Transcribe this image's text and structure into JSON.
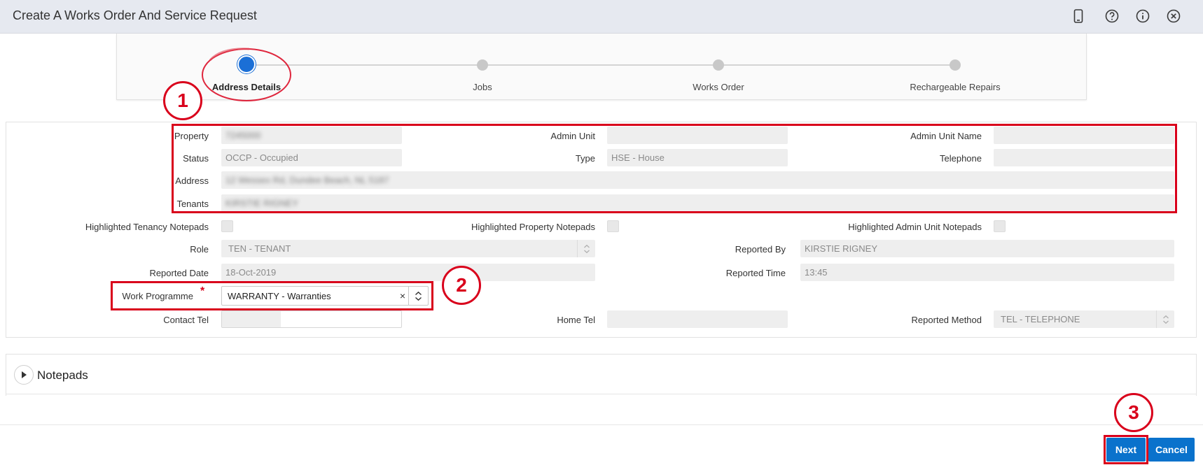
{
  "header": {
    "title": "Create A Works Order And Service Request"
  },
  "train": {
    "stops": [
      {
        "label": "Address Details",
        "active": true
      },
      {
        "label": "Jobs",
        "active": false
      },
      {
        "label": "Works Order",
        "active": false
      },
      {
        "label": "Rechargeable Repairs",
        "active": false
      }
    ]
  },
  "form": {
    "property": {
      "label": "Property",
      "value": "7245000"
    },
    "admin_unit": {
      "label": "Admin Unit",
      "value": ""
    },
    "admin_unit_name": {
      "label": "Admin Unit Name",
      "value": ""
    },
    "status": {
      "label": "Status",
      "value": "OCCP - Occupied"
    },
    "type": {
      "label": "Type",
      "value": "HSE - House"
    },
    "telephone": {
      "label": "Telephone",
      "value": ""
    },
    "address": {
      "label": "Address",
      "value": "12 Wessex Rd, Dundee Beach, NL 5187"
    },
    "tenants": {
      "label": "Tenants",
      "value": "KIRSTIE RIGNEY"
    },
    "highlighted_tenancy": {
      "label": "Highlighted Tenancy Notepads"
    },
    "highlighted_property": {
      "label": "Highlighted Property Notepads"
    },
    "highlighted_admin": {
      "label": "Highlighted Admin Unit Notepads"
    },
    "role": {
      "label": "Role",
      "value": "TEN - TENANT"
    },
    "reported_by": {
      "label": "Reported By",
      "value": "KIRSTIE RIGNEY"
    },
    "reported_date": {
      "label": "Reported Date",
      "value": "18-Oct-2019"
    },
    "reported_time": {
      "label": "Reported Time",
      "value": "13:45"
    },
    "work_programme": {
      "label": "Work Programme",
      "required_mark": "*",
      "value": "WARRANTY - Warranties",
      "clear": "×"
    },
    "contact_tel": {
      "label": "Contact Tel",
      "value": ""
    },
    "home_tel": {
      "label": "Home Tel",
      "value": ""
    },
    "reported_method": {
      "label": "Reported Method",
      "value": "TEL - TELEPHONE"
    }
  },
  "annotations": [
    "1",
    "2",
    "3"
  ],
  "notepads": {
    "label": "Notepads"
  },
  "footer": {
    "next_label": "Next",
    "cancel_label": "Cancel"
  },
  "colors": {
    "accent": "#0a72cc",
    "annotation": "#d9001b",
    "train_active": "#1b6fd6"
  }
}
